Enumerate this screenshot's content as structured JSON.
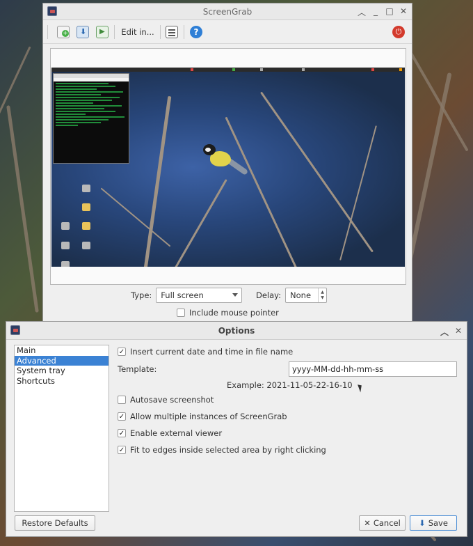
{
  "screengrab": {
    "title": "ScreenGrab",
    "toolbar": {
      "new_icon": "new-screenshot-icon",
      "save_icon": "save-icon",
      "copy_icon": "copy-icon",
      "edit_label": "Edit in...",
      "options_icon": "options-icon",
      "help_icon": "help-icon",
      "quit_icon": "power-icon"
    },
    "type_label": "Type:",
    "type_value": "Full screen",
    "delay_label": "Delay:",
    "delay_value": "None",
    "mouse_pointer_label": "Include mouse pointer"
  },
  "options": {
    "title": "Options",
    "sidebar": [
      "Main",
      "Advanced",
      "System tray",
      "Shortcuts"
    ],
    "selected_index": 1,
    "insert_date_label": "Insert current date and time in file name",
    "template_label": "Template:",
    "template_value": "yyyy-MM-dd-hh-mm-ss",
    "example_label": "Example: 2021-11-05-22-16-10",
    "autosave_label": "Autosave screenshot",
    "multiple_instances_label": "Allow multiple instances of ScreenGrab",
    "external_viewer_label": "Enable external viewer",
    "fit_edges_label": "Fit to edges inside selected area by right clicking",
    "restore_defaults_label": "Restore Defaults",
    "cancel_label": "Cancel",
    "save_label": "Save"
  },
  "colors": {
    "accent": "#3b82d4",
    "quit_red": "#d33a2c",
    "terminal_green": "#28b84a"
  }
}
